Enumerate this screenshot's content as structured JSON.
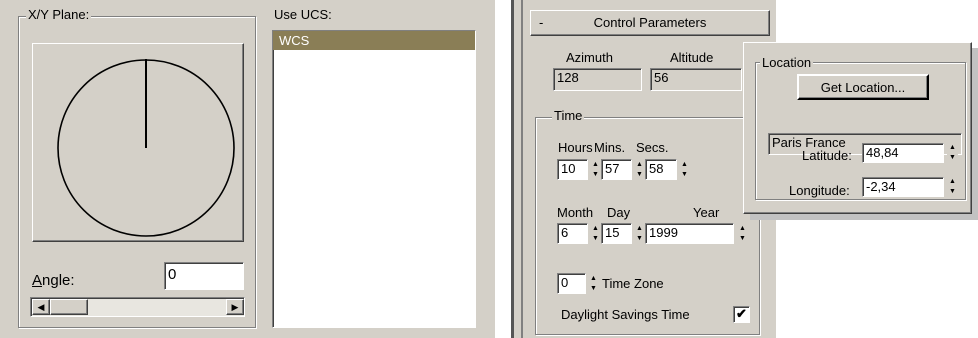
{
  "ucs_dialog": {
    "xy_plane_title": "X/Y Plane:",
    "angle_label_first": "A",
    "angle_label_rest": "ngle:",
    "angle_value": "0",
    "use_ucs_title": "Use UCS:",
    "ucs_list": [
      "WCS"
    ]
  },
  "sun_panel": {
    "rollout_title": "Control Parameters",
    "rollout_toggle": "-",
    "azimuth_label": "Azimuth",
    "azimuth_value": "128",
    "altitude_label": "Altitude",
    "altitude_value": "56",
    "time_group": "Time",
    "hours_label": "Hours",
    "hours_value": "10",
    "mins_label": "Mins.",
    "mins_value": "57",
    "secs_label": "Secs.",
    "secs_value": "58",
    "month_label": "Month",
    "month_value": "6",
    "day_label": "Day",
    "day_value": "15",
    "year_label": "Year",
    "year_value": "1999",
    "timezone_value": "0",
    "timezone_label": "Time Zone",
    "dst_label": "Daylight Savings Time",
    "dst_checked": true
  },
  "location_popup": {
    "group_title": "Location",
    "get_location_button": "Get Location...",
    "city": "Paris France",
    "latitude_label": "Latitude:",
    "latitude_value": "48,84",
    "longitude_label": "Longitude:",
    "longitude_value": "-2,34"
  },
  "colors": {
    "panel_bg": "#d4d0c8",
    "selection_bg": "#8a7e56",
    "shadow": "#808080"
  }
}
